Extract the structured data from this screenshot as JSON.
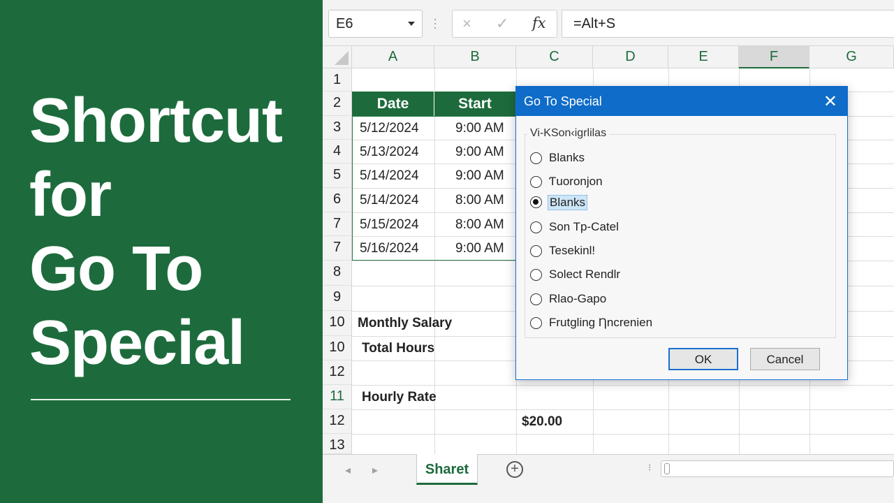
{
  "banner": {
    "title_lines": [
      "Shortcut",
      "for",
      "Go To",
      "Special"
    ]
  },
  "formula_bar": {
    "name_box": "E6",
    "cancel_icon": "×",
    "enter_icon": "✓",
    "fx_label": "fx",
    "formula": "=Alt+S"
  },
  "columns": [
    "A",
    "B",
    "C",
    "D",
    "E",
    "F",
    "G"
  ],
  "selected_column": "F",
  "rows": [
    "1",
    "2",
    "3",
    "4",
    "5",
    "6",
    "7",
    "7",
    "8",
    "9",
    "10",
    "10",
    "12",
    "11",
    "12",
    "13"
  ],
  "table": {
    "headers": [
      "Date",
      "Start"
    ],
    "data": [
      [
        "5/12/2024",
        "9:00 AM"
      ],
      [
        "5/13/2024",
        "9:00 AM"
      ],
      [
        "5/14/2024",
        "9:00 AM"
      ],
      [
        "5/14/2024",
        "8:00 AM"
      ],
      [
        "5/15/2024",
        "8:00 AM"
      ],
      [
        "5/16/2024",
        "9:00 AM"
      ]
    ]
  },
  "labels": {
    "monthly_salary": "Monthly Salary",
    "total_hours": "Total Hours",
    "hourly_rate": "Hourly Rate",
    "hourly_rate_value": "$20.00"
  },
  "sheet_tabs": {
    "active": "Sharet",
    "add": "+"
  },
  "dialog": {
    "title": "Go To Special",
    "close": "✕",
    "group_label": "Vi-KSon‹igrlilas",
    "options": [
      {
        "label": "Blanks",
        "checked": false
      },
      {
        "label": "Ƭuoronjon",
        "checked": false
      },
      {
        "label": "Blanks",
        "checked": true
      },
      {
        "label": "Son Tp-Catel",
        "checked": false
      },
      {
        "label": "Tesekinl!",
        "checked": false
      },
      {
        "label": "Solect Rendlr",
        "checked": false
      },
      {
        "label": "Rlao-Gapo",
        "checked": false
      },
      {
        "label": "Frutgling Ƞncrenien",
        "checked": false
      }
    ],
    "ok": "OK",
    "cancel": "Cancel"
  }
}
